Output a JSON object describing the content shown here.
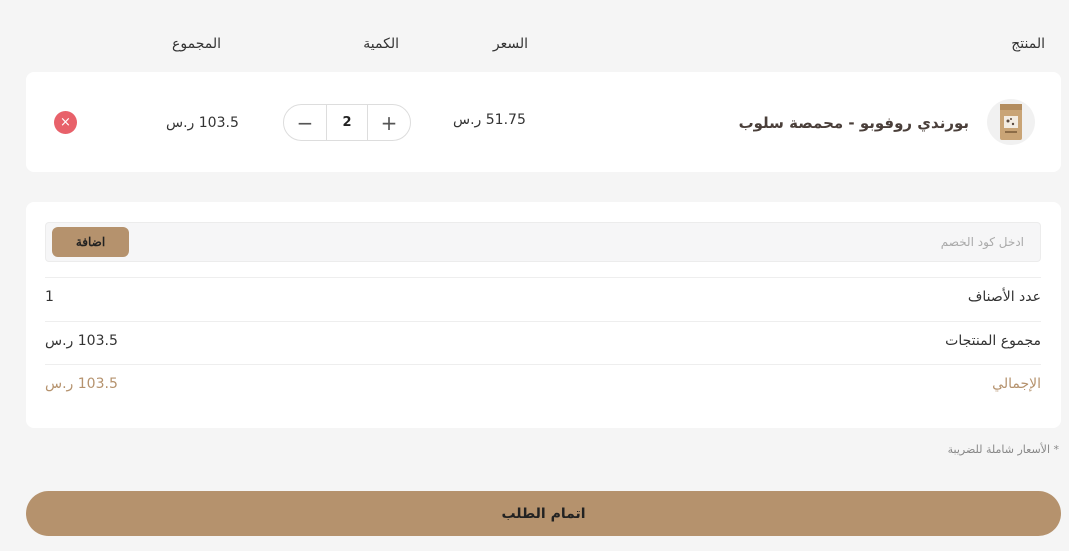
{
  "header": {
    "product": "المنتج",
    "price": "السعر",
    "quantity": "الكمية",
    "total": "المجموع"
  },
  "cart": {
    "items": [
      {
        "name": "بورندي روفوبو - محمصة سلوب",
        "price": "51.75 ر.س",
        "quantity": "2",
        "total": "103.5 ر.س",
        "image_icon": "coffee-bag-icon"
      }
    ],
    "increment_label": "+",
    "decrement_label": "−",
    "remove_label": "×"
  },
  "summary": {
    "coupon_placeholder": "ادخل كود الخصم",
    "coupon_value": "",
    "add_button": "اضافة",
    "items_count_label": "عدد الأصناف",
    "items_count_value": "1",
    "subtotal_label": "مجموع المنتجات",
    "subtotal_value": "103.5 ر.س",
    "grand_total_label": "الإجمالي",
    "grand_total_value": "103.5 ر.س"
  },
  "tax_note": "* الأسعار شاملة للضريبة",
  "checkout_button": "اتمام الطلب",
  "colors": {
    "accent": "#b5926d",
    "remove": "#e8616a",
    "background": "#f5f5f5"
  }
}
